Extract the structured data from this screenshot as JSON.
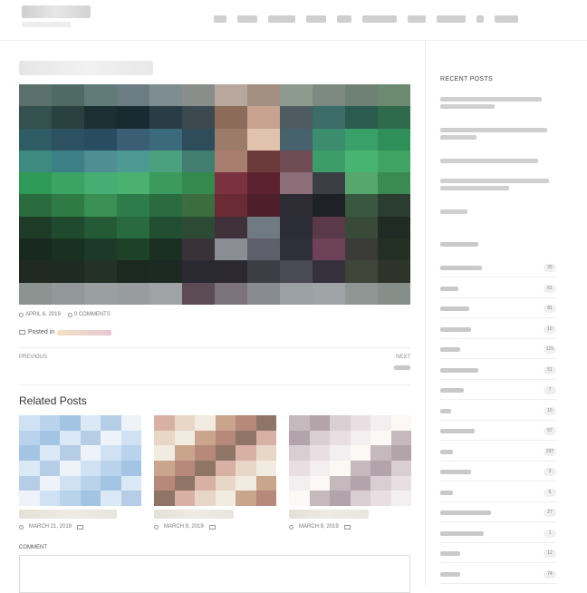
{
  "header": {
    "nav_widths": [
      14,
      22,
      30,
      22,
      16,
      38,
      20,
      32,
      8,
      26
    ]
  },
  "post": {
    "date": "APRIL 6, 2019",
    "comments": "0 COMMENTS",
    "posted_in_label": "Posted in"
  },
  "postnav": {
    "previous": "PREVIOUS",
    "next": "NEXT"
  },
  "related": {
    "heading": "Related Posts",
    "items": [
      {
        "date": "MARCH 21, 2019",
        "palette": [
          "#cfe1f2",
          "#b9d3ec",
          "#a4c4e3",
          "#dbe8f5",
          "#b5cde6",
          "#eef3f9"
        ]
      },
      {
        "date": "MARCH 9, 2019",
        "palette": [
          "#c9a58b",
          "#b7897a",
          "#8f7565",
          "#d8b0a4",
          "#e8d6c6",
          "#f2ebe2"
        ]
      },
      {
        "date": "MARCH 9, 2019",
        "palette": [
          "#c5b9bd",
          "#b3a3aa",
          "#d9cfd2",
          "#e9dfe2",
          "#f3eef0",
          "#fbf8f6"
        ]
      }
    ]
  },
  "comment": {
    "label": "COMMENT"
  },
  "sidebar": {
    "recent_heading": "RECENT POSTS",
    "recent_bars": [
      [
        112,
        60
      ],
      [
        118,
        40
      ],
      [
        108
      ],
      [
        120,
        76
      ],
      [
        30
      ]
    ],
    "categories": [
      {
        "w": 46,
        "count": "25"
      },
      {
        "w": 20,
        "count": "61"
      },
      {
        "w": 32,
        "count": "81"
      },
      {
        "w": 34,
        "count": "10"
      },
      {
        "w": 22,
        "count": "115"
      },
      {
        "w": 42,
        "count": "51"
      },
      {
        "w": 26,
        "count": "7"
      },
      {
        "w": 12,
        "count": "15"
      },
      {
        "w": 38,
        "count": "57"
      },
      {
        "w": 14,
        "count": "297"
      },
      {
        "w": 34,
        "count": "3"
      },
      {
        "w": 14,
        "count": "6"
      },
      {
        "w": 56,
        "count": "27"
      },
      {
        "w": 48,
        "count": "1"
      },
      {
        "w": 22,
        "count": "12"
      },
      {
        "w": 22,
        "count": "74"
      }
    ]
  },
  "colors": {
    "accent": "#333333",
    "border": "#eeeeee"
  }
}
